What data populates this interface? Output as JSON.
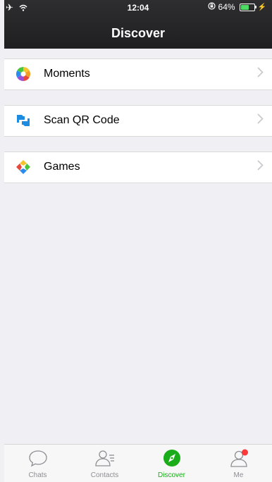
{
  "status_bar": {
    "time": "12:04",
    "battery": "64%",
    "battery_level": 0.64
  },
  "header": {
    "title": "Discover"
  },
  "groups": [
    {
      "items": [
        {
          "label": "Moments",
          "icon": "moments-icon"
        }
      ]
    },
    {
      "items": [
        {
          "label": "Scan QR Code",
          "icon": "scan-qr-icon"
        }
      ]
    },
    {
      "items": [
        {
          "label": "Games",
          "icon": "games-icon"
        }
      ]
    }
  ],
  "tabbar": {
    "tabs": [
      {
        "label": "Chats",
        "icon": "chat-bubble-icon",
        "active": false
      },
      {
        "label": "Contacts",
        "icon": "contacts-icon",
        "active": false
      },
      {
        "label": "Discover",
        "icon": "compass-icon",
        "active": true
      },
      {
        "label": "Me",
        "icon": "person-icon",
        "active": false,
        "badge": true
      }
    ]
  },
  "colors": {
    "accent": "#1aad19",
    "header_bg": "#262628",
    "badge": "#fa3a3a"
  }
}
